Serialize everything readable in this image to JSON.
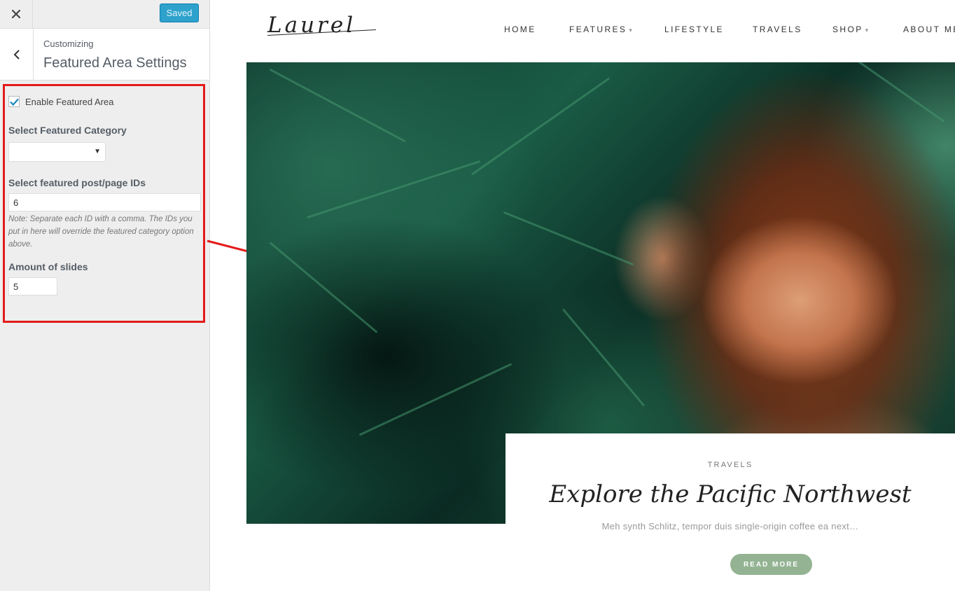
{
  "customizer": {
    "close_icon": "close-icon",
    "saved_label": "Saved",
    "back_icon": "chevron-left-icon",
    "breadcrumb": "Customizing",
    "panel_title": "Featured Area Settings",
    "enable_featured": {
      "label": "Enable Featured Area",
      "checked": true
    },
    "featured_category": {
      "title": "Select Featured Category",
      "value": ""
    },
    "featured_ids": {
      "title": "Select featured post/page IDs",
      "value": "6",
      "note": "Note: Separate each ID with a comma. The IDs you put in here will override the featured category option above."
    },
    "slides": {
      "title": "Amount of slides",
      "value": "5"
    },
    "colors": {
      "saved_button": "#2ea2cc",
      "highlight": "#e31b1b"
    }
  },
  "site": {
    "logo": "Laurel",
    "nav": [
      {
        "label": "HOME",
        "has_dropdown": false
      },
      {
        "label": "FEATURES",
        "has_dropdown": true
      },
      {
        "label": "LIFESTYLE",
        "has_dropdown": false
      },
      {
        "label": "TRAVELS",
        "has_dropdown": false
      },
      {
        "label": "SHOP",
        "has_dropdown": true
      },
      {
        "label": "ABOUT ME",
        "has_dropdown": false
      }
    ],
    "featured_post": {
      "category": "TRAVELS",
      "title": "Explore the Pacific Northwest",
      "excerpt": "Meh synth Schlitz, tempor duis single-origin coffee ea next…",
      "button": "READ MORE"
    },
    "colors": {
      "read_more_button": "#93b393"
    }
  }
}
